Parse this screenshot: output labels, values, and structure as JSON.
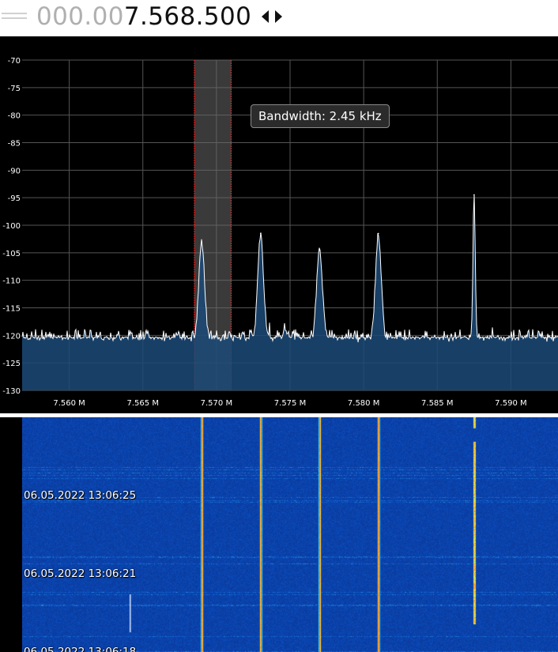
{
  "header": {
    "frequency_dim": "000.00",
    "frequency_main": "7.568.500",
    "step_arrows_icon": "left-right-arrows-icon",
    "menu_icon": "menu-handle-icon"
  },
  "spectrum": {
    "tooltip": "Bandwidth: 2.45 kHz",
    "y_ticks": [
      "-70",
      "-75",
      "-80",
      "-85",
      "-90",
      "-95",
      "-100",
      "-105",
      "-110",
      "-115",
      "-120",
      "-125",
      "-130"
    ],
    "x_ticks": [
      "7.560 M",
      "7.565 M",
      "7.570 M",
      "7.575 M",
      "7.580 M",
      "7.585 M",
      "7.590 M"
    ],
    "colors": {
      "background": "#000000",
      "fill": "#1c4a78",
      "trace": "#ffffff",
      "grid": "#555555",
      "passband": "#6a6a6a",
      "edge": "#ff2020"
    }
  },
  "waterfall": {
    "timestamps": [
      "06.05.2022 13:06:25",
      "06.05.2022 13:06:21",
      "06.05.2022 13:06:18"
    ]
  },
  "chart_data": {
    "type": "line",
    "title": "",
    "xlabel": "",
    "ylabel": "",
    "xlim": [
      7.5568,
      7.5932
    ],
    "ylim": [
      -130,
      -70
    ],
    "grid": true,
    "noise_floor": -121,
    "passband": [
      7.5685,
      7.571
    ],
    "series": [
      {
        "x": [
          7.569,
          7.573,
          7.577,
          7.581,
          7.5875
        ],
        "values": [
          -103,
          -101.5,
          -104.5,
          -101.5,
          -94.5
        ]
      }
    ]
  }
}
